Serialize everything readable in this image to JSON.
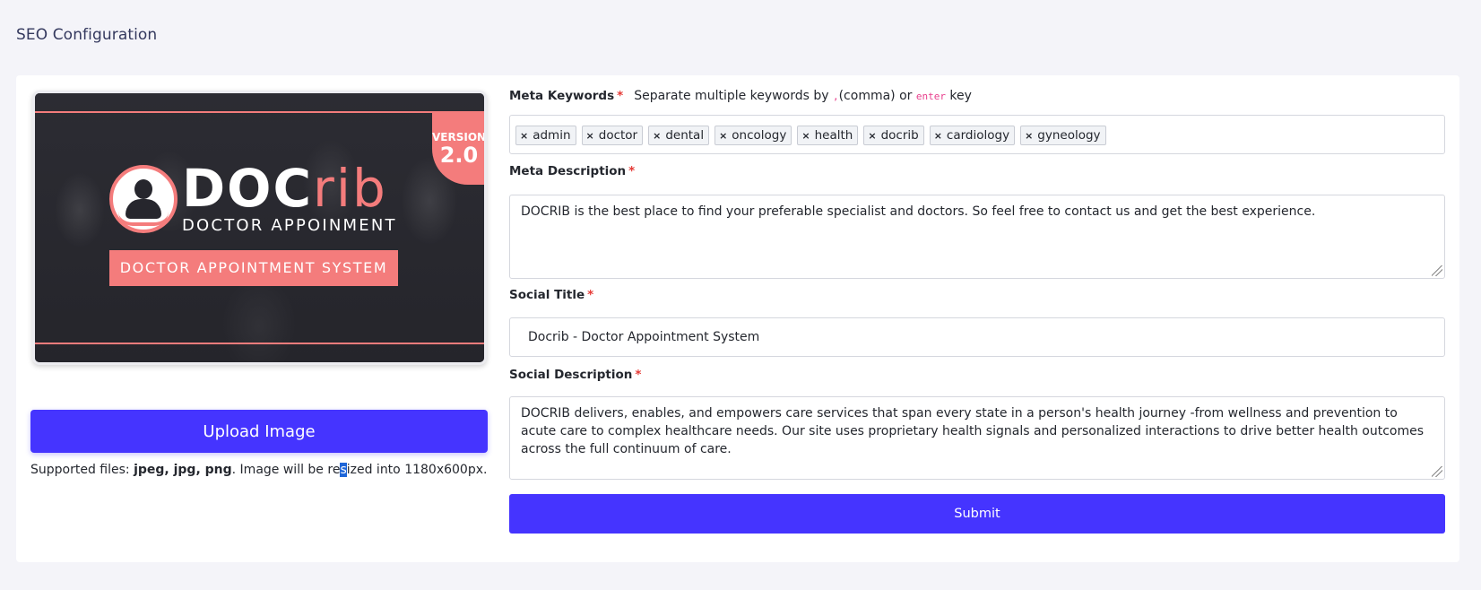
{
  "page": {
    "title": "SEO Configuration"
  },
  "banner": {
    "logo_doc": "DOC",
    "logo_rib": "rib",
    "subtitle": "DOCTOR APPOINMENT",
    "band_text": "DOCTOR APPOINTMENT SYSTEM",
    "version_label": "VERSION",
    "version_number": "2.0"
  },
  "upload": {
    "button_label": "Upload Image",
    "supported_prefix": "Supported files: ",
    "supported_types": "jpeg, jpg, png",
    "supported_middle_a": ". Image will be re",
    "supported_selected": "s",
    "supported_suffix": "ized into 1180x600px."
  },
  "meta_keywords": {
    "label": "Meta Keywords",
    "required": "*",
    "hint_prefix": "Separate multiple keywords by ",
    "hint_comma_code": ",",
    "hint_middle": "(comma) or ",
    "hint_enter_code": "enter",
    "hint_suffix": " key",
    "tags": [
      "admin",
      "doctor",
      "dental",
      "oncology",
      "health",
      "docrib",
      "cardiology",
      "gyneology"
    ],
    "remove_glyph": "×"
  },
  "meta_description": {
    "label": "Meta Description",
    "required": "*",
    "value": "DOCRIB is the best place to find your preferable specialist and doctors. So feel free to contact us and get the best experience."
  },
  "social_title": {
    "label": "Social Title",
    "required": "*",
    "value": "Docrib - Doctor Appointment System"
  },
  "social_description": {
    "label": "Social Description",
    "required": "*",
    "value": "DOCRIB delivers, enables, and empowers care services that span every state in a person's health journey -from wellness and prevention to acute care to complex healthcare needs. Our site uses proprietary health signals and personalized interactions to drive better health outcomes across the full continuum of care."
  },
  "submit": {
    "label": "Submit"
  },
  "colors": {
    "primary": "#4534ff",
    "accent": "#f47c7c",
    "required": "#e53935"
  }
}
